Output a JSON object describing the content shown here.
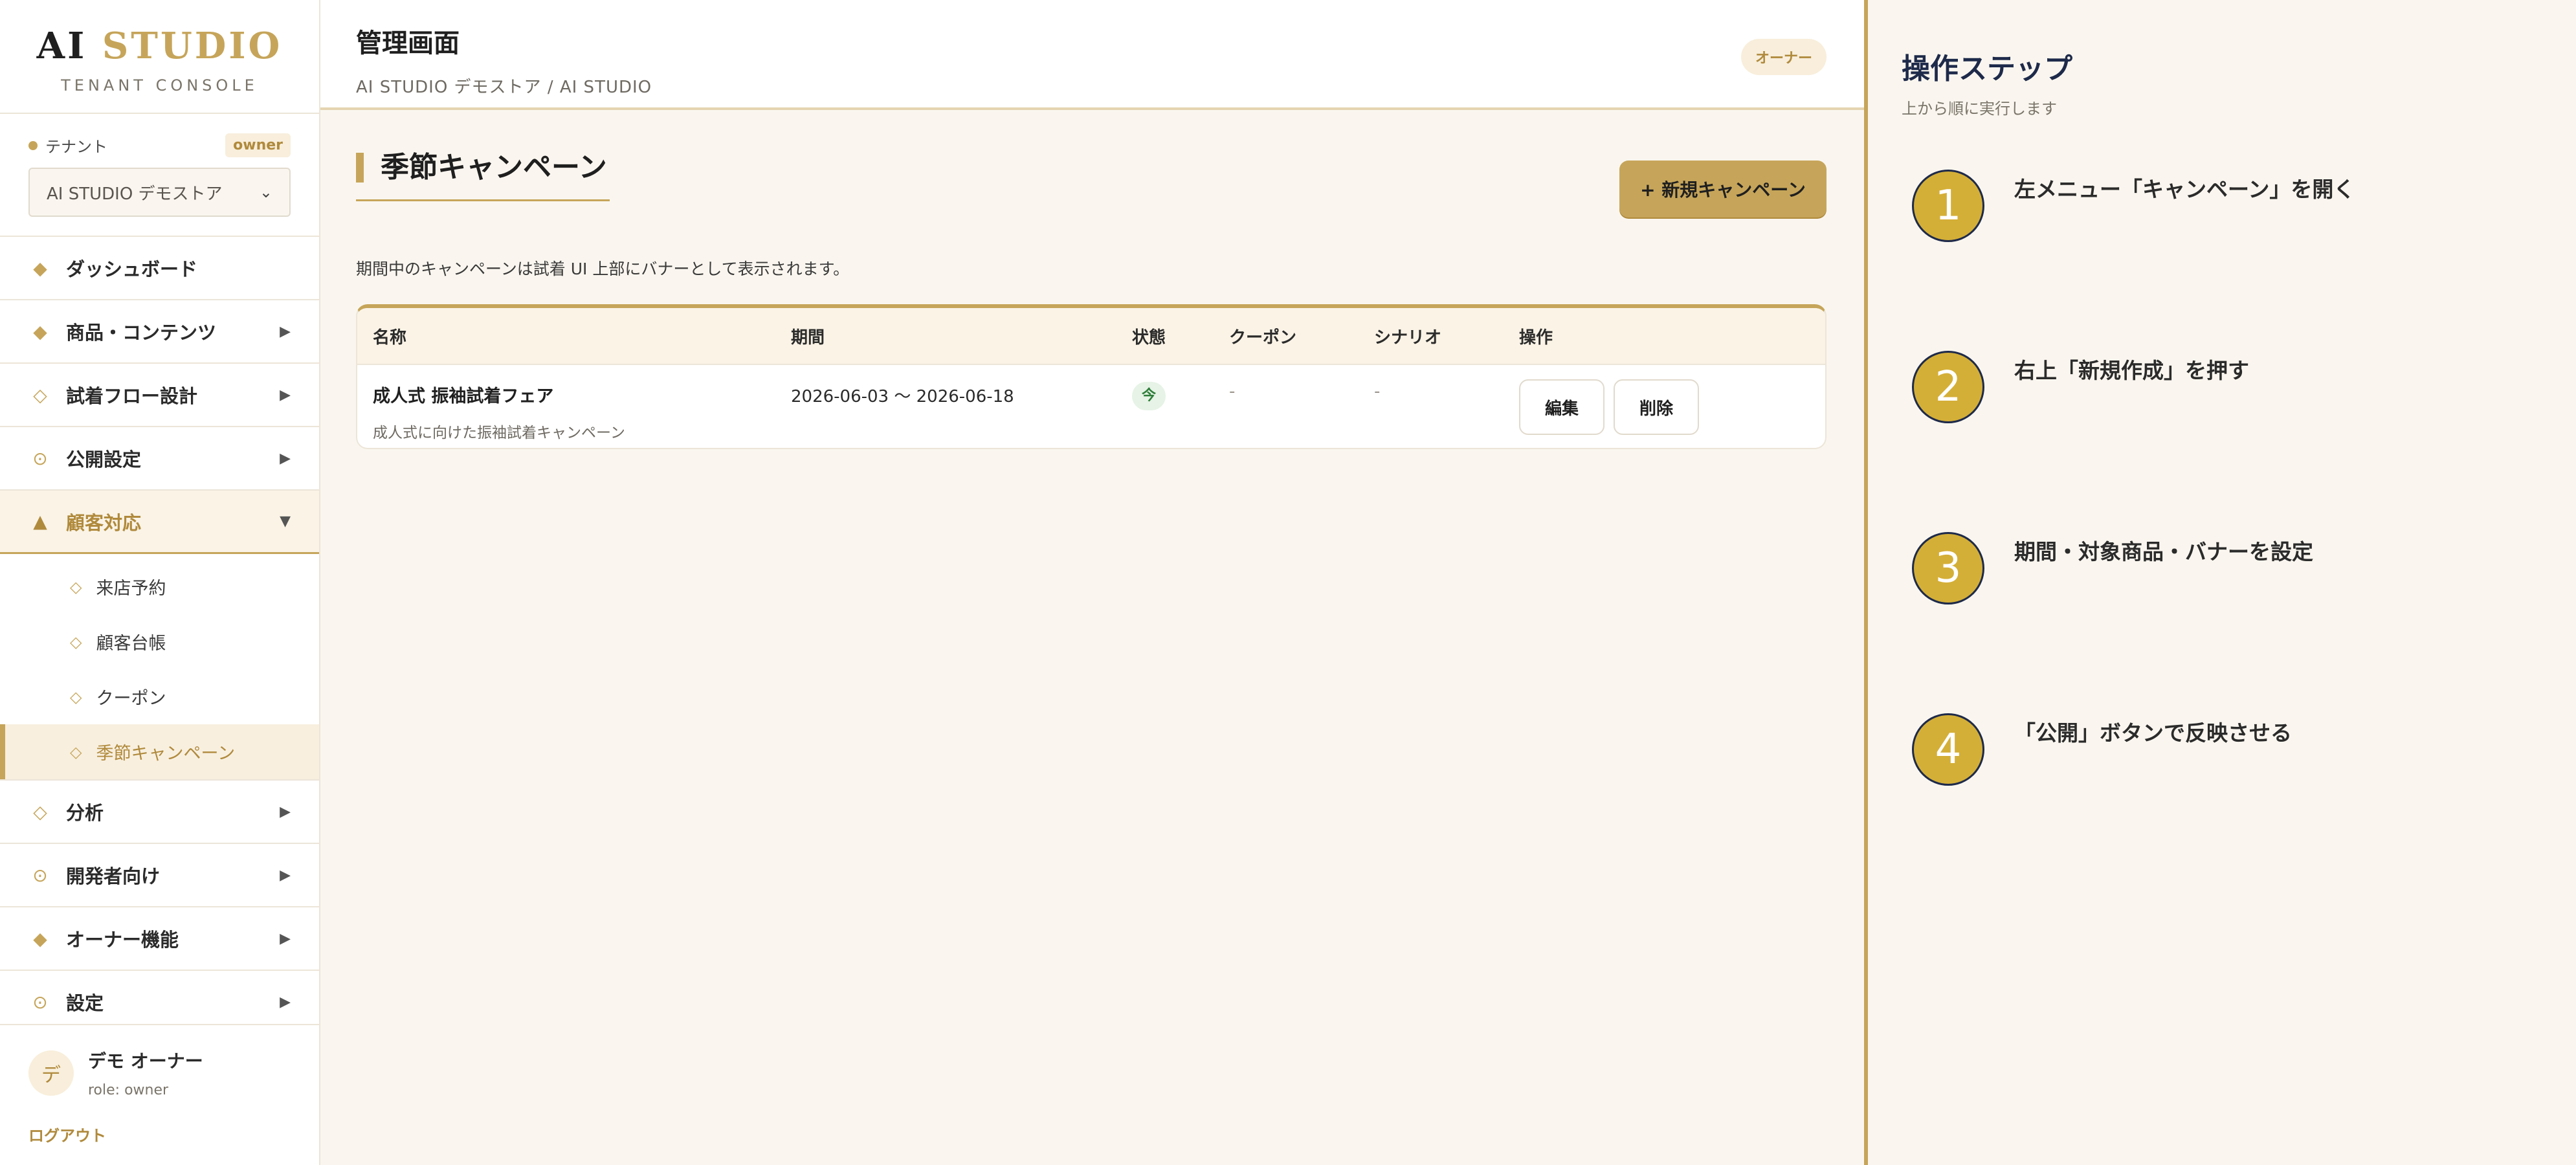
{
  "brand": {
    "logo_left": "AI",
    "logo_right": "STUDIO",
    "subtitle": "TENANT CONSOLE"
  },
  "tenant": {
    "label": "テナント",
    "role_badge": "owner",
    "selected": "AI STUDIO デモストア"
  },
  "nav": {
    "dashboard": "ダッシュボード",
    "products": "商品・コンテンツ",
    "flow": "試着フロー設計",
    "publish": "公開設定",
    "customer": "顧客対応",
    "customer_sub": [
      "来店予約",
      "顧客台帳",
      "クーポン",
      "季節キャンペーン"
    ],
    "analytics": "分析",
    "developers": "開発者向け",
    "owner": "オーナー機能",
    "settings": "設定"
  },
  "user": {
    "avatar": "デ",
    "name": "デモ オーナー",
    "role": "role: owner",
    "logout": "ログアウト"
  },
  "header": {
    "title": "管理画面",
    "breadcrumb": "AI STUDIO デモストア / AI STUDIO",
    "role_pill": "オーナー"
  },
  "page": {
    "title": "季節キャンペーン",
    "new_button": "+ 新規キャンペーン",
    "description": "期間中のキャンペーンは試着 UI 上部にバナーとして表示されます。"
  },
  "table": {
    "headers": [
      "名称",
      "期間",
      "状態",
      "クーポン",
      "シナリオ",
      "操作"
    ],
    "rows": [
      {
        "name": "成人式 振袖試着フェア",
        "sub": "成人式に向けた振袖試着キャンペーン",
        "period": "2026-06-03 〜 2026-06-18",
        "status": "今",
        "coupon": "-",
        "scenario": "-",
        "edit": "編集",
        "delete": "削除"
      }
    ]
  },
  "steps": {
    "title": "操作ステップ",
    "subtitle": "上から順に実行します",
    "items": [
      {
        "num": "1",
        "text": "左メニュー「キャンペーン」を開く"
      },
      {
        "num": "2",
        "text": "右上「新規作成」を押す"
      },
      {
        "num": "3",
        "text": "期間・対象商品・バナーを設定"
      },
      {
        "num": "4",
        "text": "「公開」ボタンで反映させる"
      }
    ]
  },
  "colors": {
    "accent": "#c6a55a",
    "step_circle": "#d4af37",
    "navy": "#1e2a4a",
    "background": "#faf6ef"
  }
}
